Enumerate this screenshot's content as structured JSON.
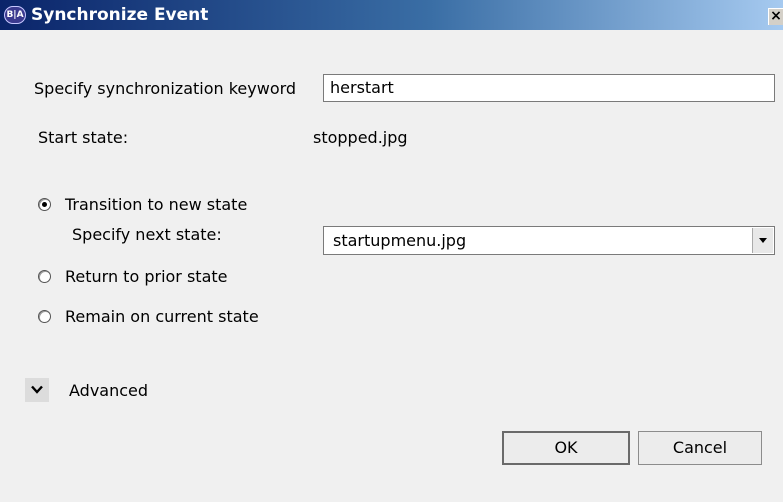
{
  "window": {
    "title": "Synchronize Event",
    "app_icon_text": "B|A",
    "close_glyph": "×"
  },
  "form": {
    "keyword_label": "Specify synchronization keyword",
    "keyword_value": "herstart",
    "start_state_label": "Start state:",
    "start_state_value": "stopped.jpg",
    "options": [
      {
        "label": "Transition to new state",
        "checked": true
      },
      {
        "label": "Return to prior state",
        "checked": false
      },
      {
        "label": "Remain on current state",
        "checked": false
      }
    ],
    "next_state_label": "Specify next state:",
    "next_state_value": "startupmenu.jpg"
  },
  "advanced": {
    "label": "Advanced",
    "icon": "chevron-down-icon"
  },
  "buttons": {
    "ok": "OK",
    "cancel": "Cancel"
  }
}
